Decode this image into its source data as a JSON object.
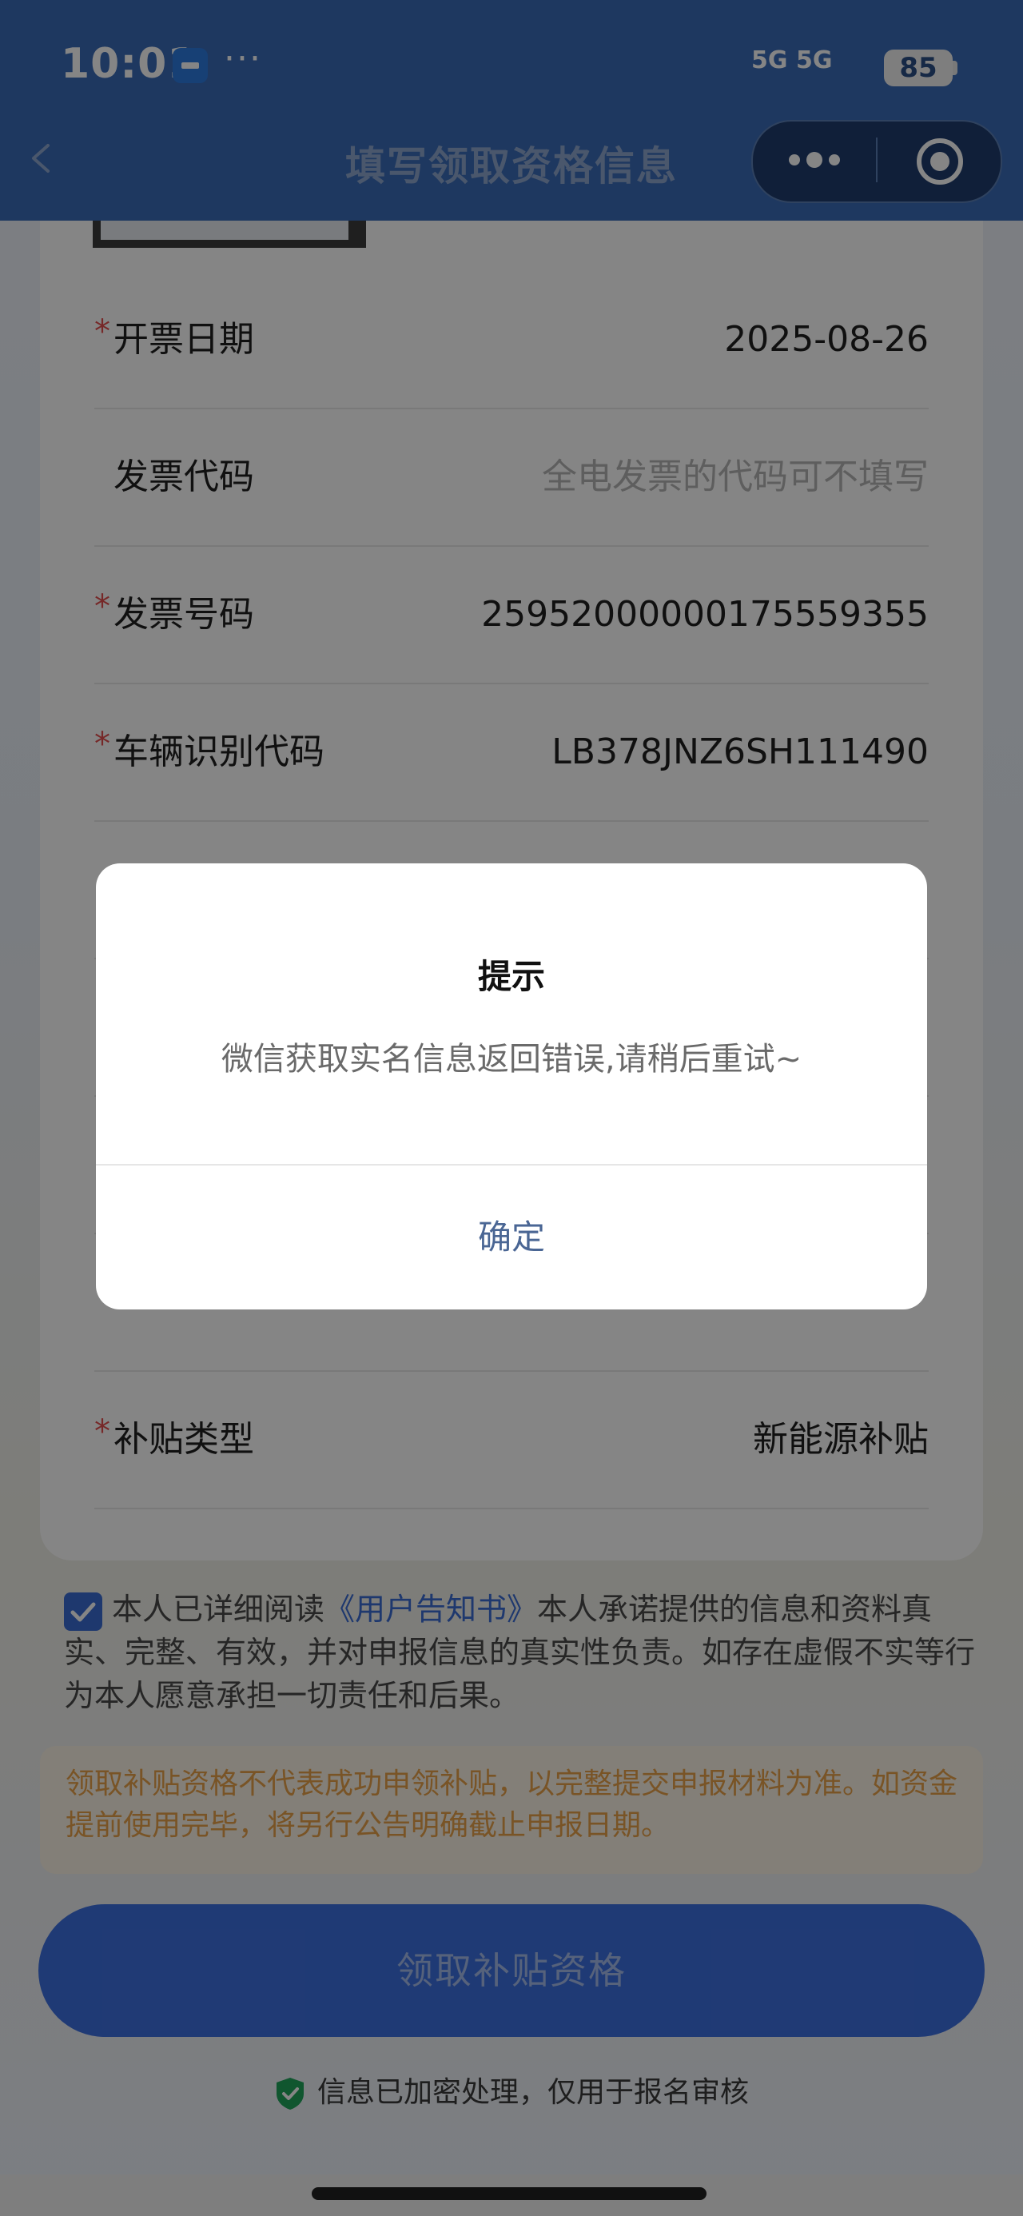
{
  "status_bar": {
    "time": "10:01",
    "dots": "···",
    "signal": "5G 5G",
    "battery": "85"
  },
  "nav": {
    "title": "填写领取资格信息"
  },
  "form": {
    "rows": [
      {
        "required": true,
        "label": "开票日期",
        "value": "2025-08-26",
        "placeholder": false
      },
      {
        "required": false,
        "label": "发票代码",
        "value": "全电发票的代码可不填写",
        "placeholder": true
      },
      {
        "required": true,
        "label": "发票号码",
        "value": "25952000000175559355",
        "placeholder": false
      },
      {
        "required": true,
        "label": "车辆识别代码",
        "value": "LB378JNZ6SH111490",
        "placeholder": false
      },
      {
        "required": true,
        "label": "补贴类型",
        "value": "新能源补贴",
        "placeholder": false
      }
    ],
    "required_mark": "*"
  },
  "agreement": {
    "checked": true,
    "prefix": "本人已详细阅读",
    "link": "《用户告知书》",
    "suffix": "本人承诺提供的信息和资料真实、完整、有效，并对申报信息的真实性负责。如存在虚假不实等行为本人愿意承担一切责任和后果。"
  },
  "notice": {
    "text": "领取补贴资格不代表成功申领补贴，以完整提交申报材料为准。如资金提前使用完毕，将另行公告明确截止申报日期。"
  },
  "submit": {
    "label": "领取补贴资格"
  },
  "secure": {
    "text": "信息已加密处理，仅用于报名审核"
  },
  "dialog": {
    "title": "提示",
    "message": "微信获取实名信息返回错误,请稍后重试~",
    "ok_label": "确定"
  },
  "colors": {
    "header": "#3a6bb8",
    "accent": "#3d6fe0",
    "required": "#e34d4d",
    "notice": "#e8a14a"
  }
}
